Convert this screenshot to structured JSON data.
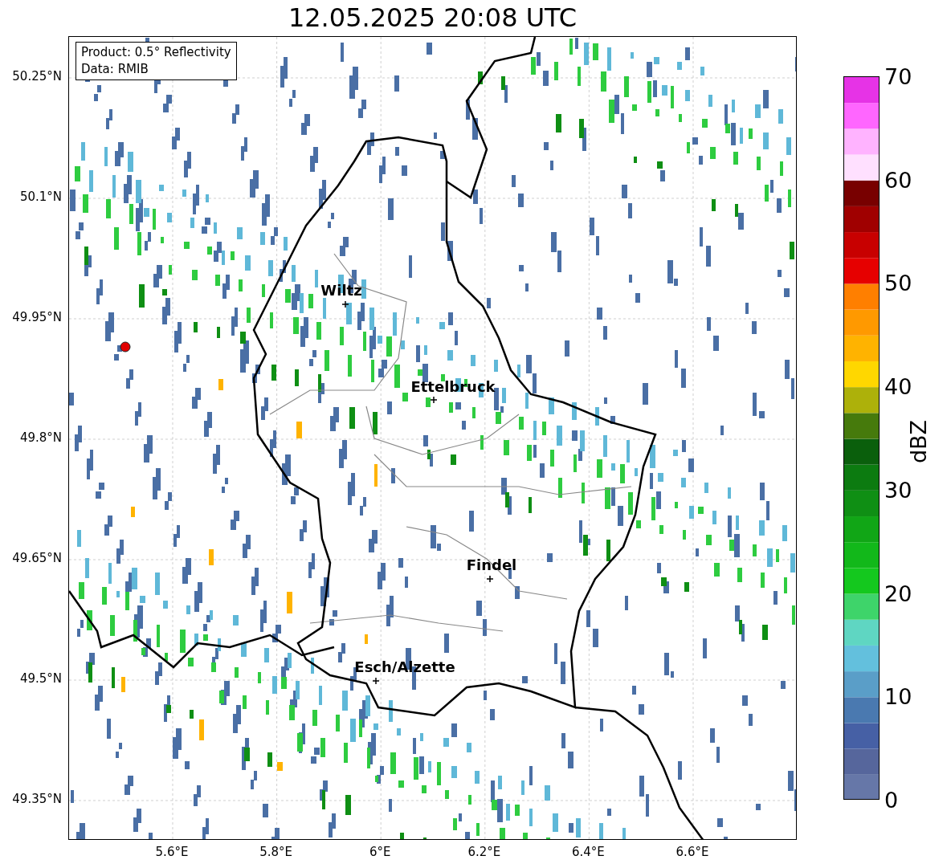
{
  "title": "12.05.2025 20:08 UTC",
  "info_box": {
    "lines": [
      "Product: 0.5° Reflectivity",
      "Data: RMIB"
    ]
  },
  "y_ticks": [
    "50.25°N",
    "50.1°N",
    "49.95°N",
    "49.8°N",
    "49.65°N",
    "49.5°N",
    "49.35°N"
  ],
  "x_ticks": [
    "5.6°E",
    "5.8°E",
    "6°E",
    "6.2°E",
    "6.4°E",
    "6.6°E"
  ],
  "cities": [
    {
      "name": "Wiltz"
    },
    {
      "name": "Ettelbruck"
    },
    {
      "name": "Findel"
    },
    {
      "name": "Esch/Alzette"
    }
  ],
  "colorbar": {
    "label": "dBZ",
    "ticks": [
      "70",
      "60",
      "50",
      "40",
      "30",
      "20",
      "10",
      "0"
    ],
    "steps": [
      {
        "color": "#6677a8"
      },
      {
        "color": "#56669c"
      },
      {
        "color": "#4660a5"
      },
      {
        "color": "#4a79b0"
      },
      {
        "color": "#5a9ec8"
      },
      {
        "color": "#63c0dd"
      },
      {
        "color": "#5fd6c2"
      },
      {
        "color": "#3ed46a"
      },
      {
        "color": "#14c81e"
      },
      {
        "color": "#12b81a"
      },
      {
        "color": "#11a616"
      },
      {
        "color": "#0f8f14"
      },
      {
        "color": "#0c7b10"
      },
      {
        "color": "#0a5f0c"
      },
      {
        "color": "#467a0c"
      },
      {
        "color": "#adb10a"
      },
      {
        "color": "#ffd700"
      },
      {
        "color": "#ffb300"
      },
      {
        "color": "#ff9900"
      },
      {
        "color": "#ff7f00"
      },
      {
        "color": "#e60000"
      },
      {
        "color": "#c80000"
      },
      {
        "color": "#a00000"
      },
      {
        "color": "#780000"
      },
      {
        "color": "#ffe0ff"
      },
      {
        "color": "#ffb3ff"
      },
      {
        "color": "#ff66ff"
      },
      {
        "color": "#e633e6"
      }
    ]
  }
}
